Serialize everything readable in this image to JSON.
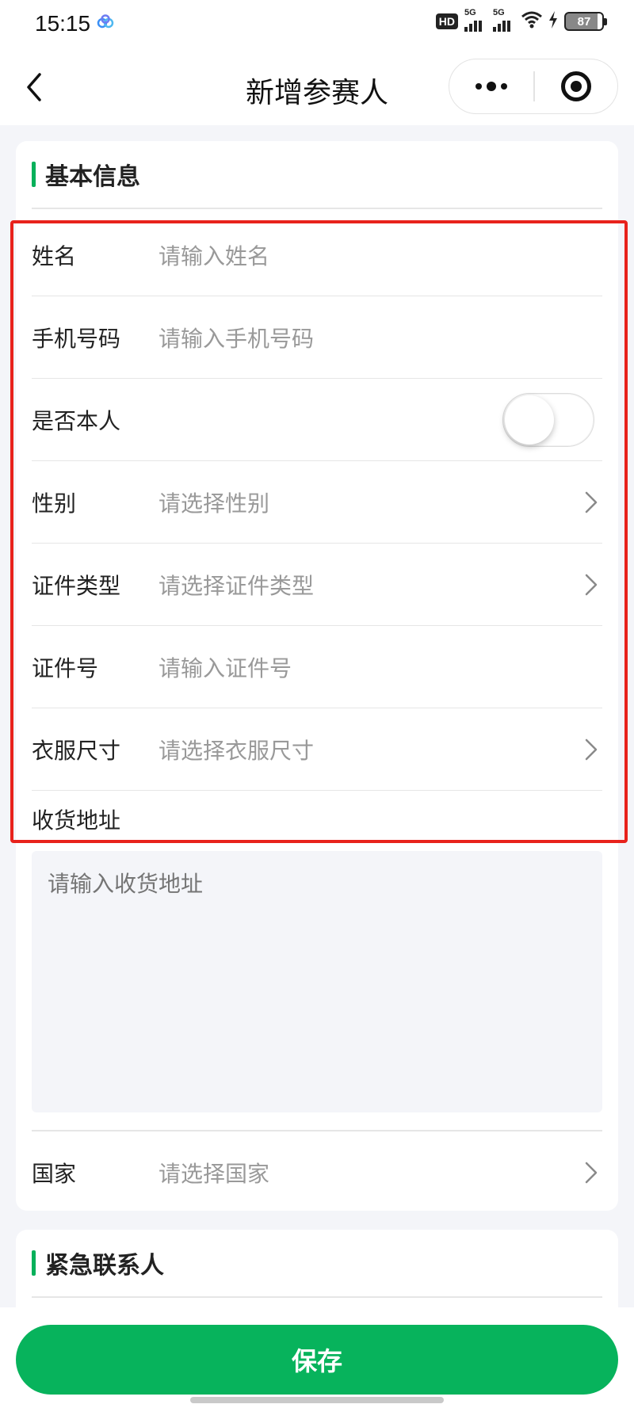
{
  "status_bar": {
    "time": "15:15",
    "hd_label": "HD",
    "signal1_label": "5G",
    "signal2_label": "5G",
    "battery": "87"
  },
  "nav": {
    "title": "新增参赛人"
  },
  "basic_section": {
    "title": "基本信息",
    "fields": {
      "name": {
        "label": "姓名",
        "placeholder": "请输入姓名"
      },
      "phone": {
        "label": "手机号码",
        "placeholder": "请输入手机号码"
      },
      "self": {
        "label": "是否本人",
        "toggle_on": false
      },
      "gender": {
        "label": "性别",
        "placeholder": "请选择性别"
      },
      "id_type": {
        "label": "证件类型",
        "placeholder": "请选择证件类型"
      },
      "id_number": {
        "label": "证件号",
        "placeholder": "请输入证件号"
      },
      "clothing_size": {
        "label": "衣服尺寸",
        "placeholder": "请选择衣服尺寸"
      },
      "address": {
        "label": "收货地址",
        "placeholder": "请输入收货地址"
      },
      "country": {
        "label": "国家",
        "placeholder": "请选择国家"
      }
    }
  },
  "emergency_section": {
    "title": "紧急联系人"
  },
  "footer": {
    "save_label": "保存"
  },
  "colors": {
    "accent": "#07b35c",
    "highlight": "#e8221c",
    "background": "#f4f5f9"
  }
}
